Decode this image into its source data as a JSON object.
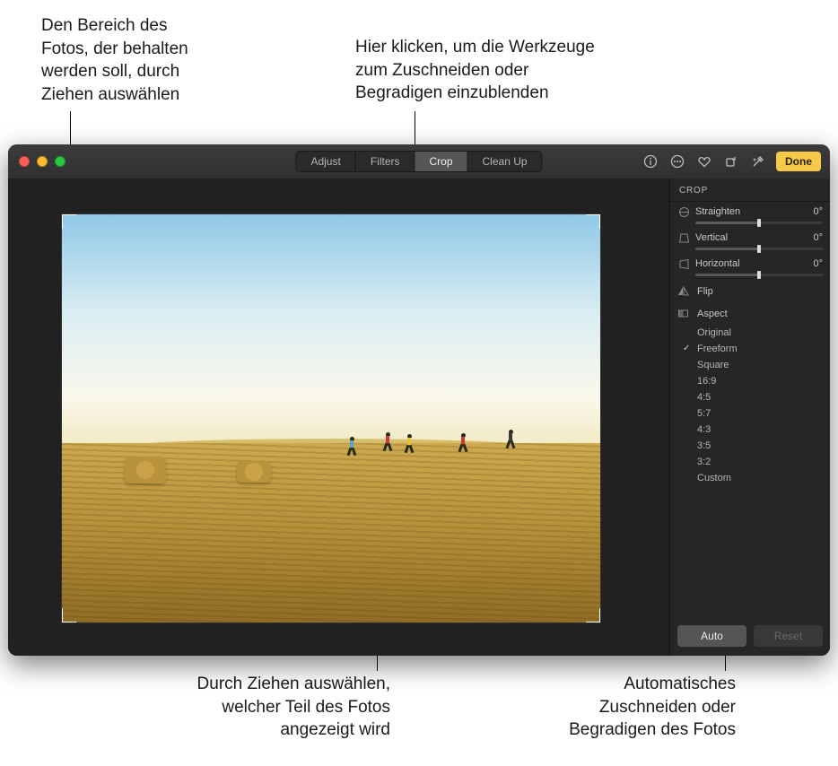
{
  "callouts": {
    "top_left": "Den Bereich des\nFotos, der behalten\nwerden soll, durch\nZiehen auswählen",
    "top_right": "Hier klicken, um die Werkzeuge\nzum Zuschneiden oder\nBegradigen einzublenden",
    "bottom_left": "Durch Ziehen auswählen,\nwelcher Teil des Fotos\nangezeigt wird",
    "bottom_right": "Automatisches\nZuschneiden oder\nBegradigen des Fotos"
  },
  "toolbar": {
    "tabs": {
      "adjust": "Adjust",
      "filters": "Filters",
      "crop": "Crop",
      "cleanup": "Clean Up"
    },
    "active_tab": "crop",
    "done": "Done"
  },
  "sidebar": {
    "title": "CROP",
    "sliders": {
      "straighten": {
        "label": "Straighten",
        "value": "0°"
      },
      "vertical": {
        "label": "Vertical",
        "value": "0°"
      },
      "horizontal": {
        "label": "Horizontal",
        "value": "0°"
      }
    },
    "flip": "Flip",
    "aspect_label": "Aspect",
    "aspect_options": [
      "Original",
      "Freeform",
      "Square",
      "16:9",
      "4:5",
      "5:7",
      "4:3",
      "3:5",
      "3:2",
      "Custom"
    ],
    "aspect_selected": "Freeform",
    "auto": "Auto",
    "reset": "Reset"
  }
}
